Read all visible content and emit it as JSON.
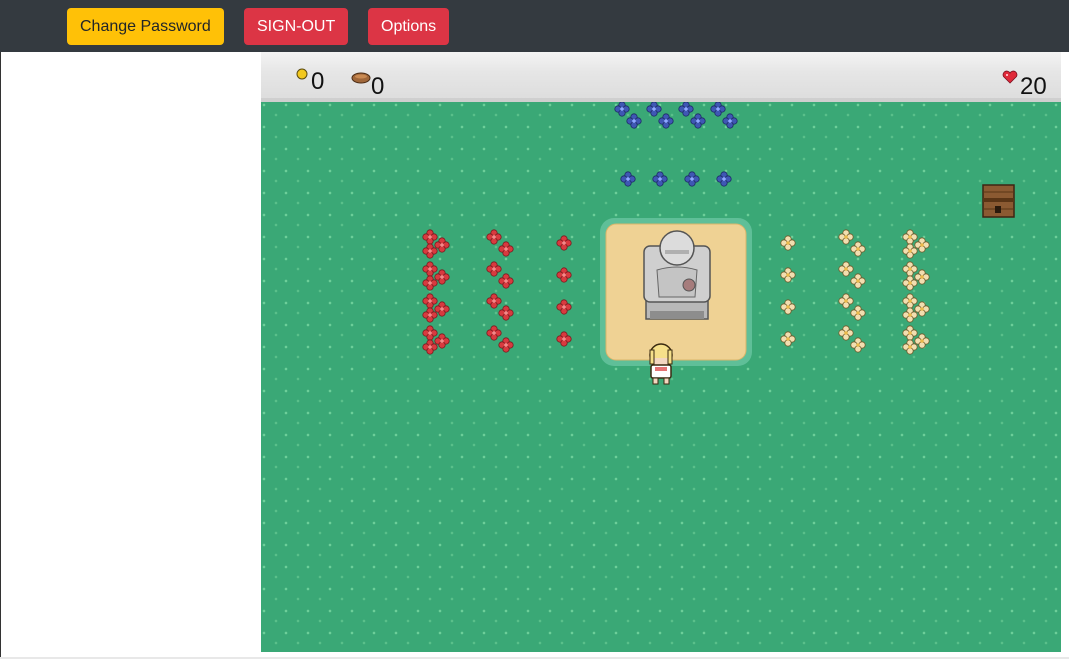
{
  "topbar": {
    "change_password_label": "Change Password",
    "sign_out_label": "SIGN-OUT",
    "options_label": "Options"
  },
  "hud": {
    "coins": "0",
    "food": "0",
    "health": "20",
    "coin_icon": "coin-icon",
    "food_icon": "bread-icon",
    "health_icon": "heart-icon"
  },
  "colors": {
    "navbar": "#343a40",
    "warning": "#ffc107",
    "danger": "#dc3545",
    "grass": "#3aa876",
    "sand": "#efd294",
    "red_flower": "#d83a3f",
    "blue_flower": "#3f57b4",
    "cream_flower": "#f2deb0"
  },
  "scene": {
    "statue": "stone-statue",
    "chest": "wooden-chest",
    "player": "blonde-girl-character"
  }
}
